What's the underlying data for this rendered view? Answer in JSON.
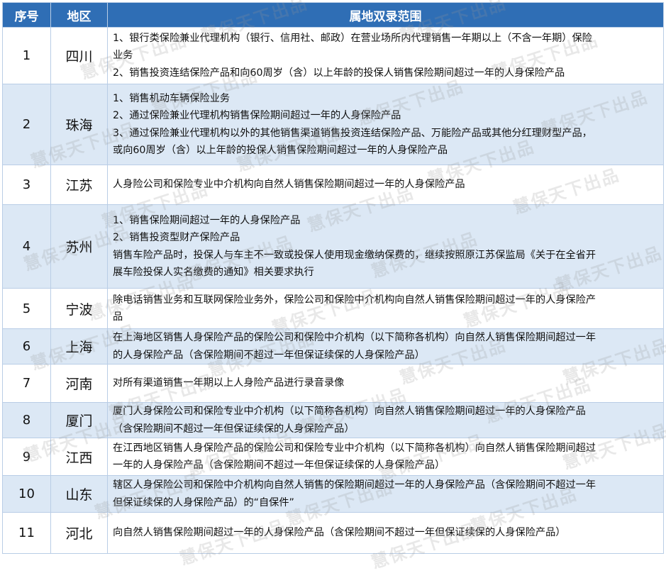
{
  "header": {
    "col_number": "序号",
    "col_region": "地区",
    "col_scope": "属地双录范围"
  },
  "rows": [
    {
      "number": "1",
      "region": "四川",
      "shaded": false,
      "height": 80,
      "lines": [
        "1、银行类保险兼业代理机构（银行、信用社、邮政）在营业场所内代理销售一年期以上（不含一年期）保险",
        "业务",
        "2、销售投资连结保险产品和向60周岁（含）以上年龄的投保人销售保险期间超过一年的人身保险产品"
      ]
    },
    {
      "number": "2",
      "region": "珠海",
      "shaded": true,
      "height": 114,
      "lines": [
        "1、销售机动车辆保险业务",
        "2、通过保险兼业代理机构销售保险期间超过一年的人身保险产品",
        "3、通过保险兼业代理机构以外的其他销售渠道销售投资连结保险产品、万能险产品或其他分红理财型产品，",
        "或向60周岁（含）以上年龄的投保人销售保险期间超过一年的人身保险产品"
      ]
    },
    {
      "number": "3",
      "region": "江苏",
      "shaded": false,
      "height": 56,
      "lines": [
        "人身险公司和保险专业中介机构向自然人销售保险期间超过一年的人身保险产品"
      ]
    },
    {
      "number": "4",
      "region": "苏州",
      "shaded": true,
      "height": 118,
      "lines": [
        "1、销售保险期间超过一年的人身保险产品",
        "2、销售投资型财产保险产品",
        "销售车险产品时，投保人与车主不一致或投保人使用现金缴纳保费的，继续按照原江苏保监局《关于在全省开",
        "展车险投保人实名缴费的通知》相关要求执行"
      ]
    },
    {
      "number": "5",
      "region": "宁波",
      "shaded": false,
      "height": 57,
      "lines": [
        "除电话销售业务和互联网保险业务外，保险公司和保险中介机构向自然人销售保险期间超过一年的人身保险产",
        "品"
      ]
    },
    {
      "number": "6",
      "region": "上海",
      "shaded": true,
      "height": 50,
      "lines": [
        "在上海地区销售人身保险产品的保险公司和保险中介机构（以下简称各机构）向自然人销售保险期间超过一年",
        "的人身保险产品（含保险期间不超过一年但保证续保的人身保险产品）"
      ]
    },
    {
      "number": "7",
      "region": "河南",
      "shaded": false,
      "height": 54,
      "lines": [
        "对所有渠道销售一年期以上人身险产品进行录音录像"
      ]
    },
    {
      "number": "8",
      "region": "厦门",
      "shaded": true,
      "height": 47,
      "lines": [
        "厦门人身保险公司和保险专业中介机构（以下简称各机构）向自然人销售保险期间超过一年的人身保险产品",
        "（含保险期间不超过一年但保证续保的人身保险产品）"
      ]
    },
    {
      "number": "9",
      "region": "江西",
      "shaded": false,
      "height": 53,
      "lines": [
        "在江西地区销售人身保险产品的保险公司和保险专业中介机构（以下简称各机构）向自然人销售保险期间超过",
        "一年的人身保险产品（含保险期间不超过一年但保证续保的人身保险产品）"
      ]
    },
    {
      "number": "10",
      "region": "山东",
      "shaded": true,
      "height": 52,
      "lines": [
        "辖区人身保险公司和保险中介机构向自然人销售的保险期间超过一年的人身保险产品（含保险期间不超过一年",
        "但保证续保的人身保险产品）的“自保件”"
      ]
    },
    {
      "number": "11",
      "region": "河北",
      "shaded": false,
      "height": 58,
      "lines": [
        "向自然人销售保险期间超过一年的人身保险产品（含保险期间不超过一年但保证续保的人身保险产品）"
      ]
    }
  ],
  "watermark": {
    "text": "慧保天下出品"
  }
}
